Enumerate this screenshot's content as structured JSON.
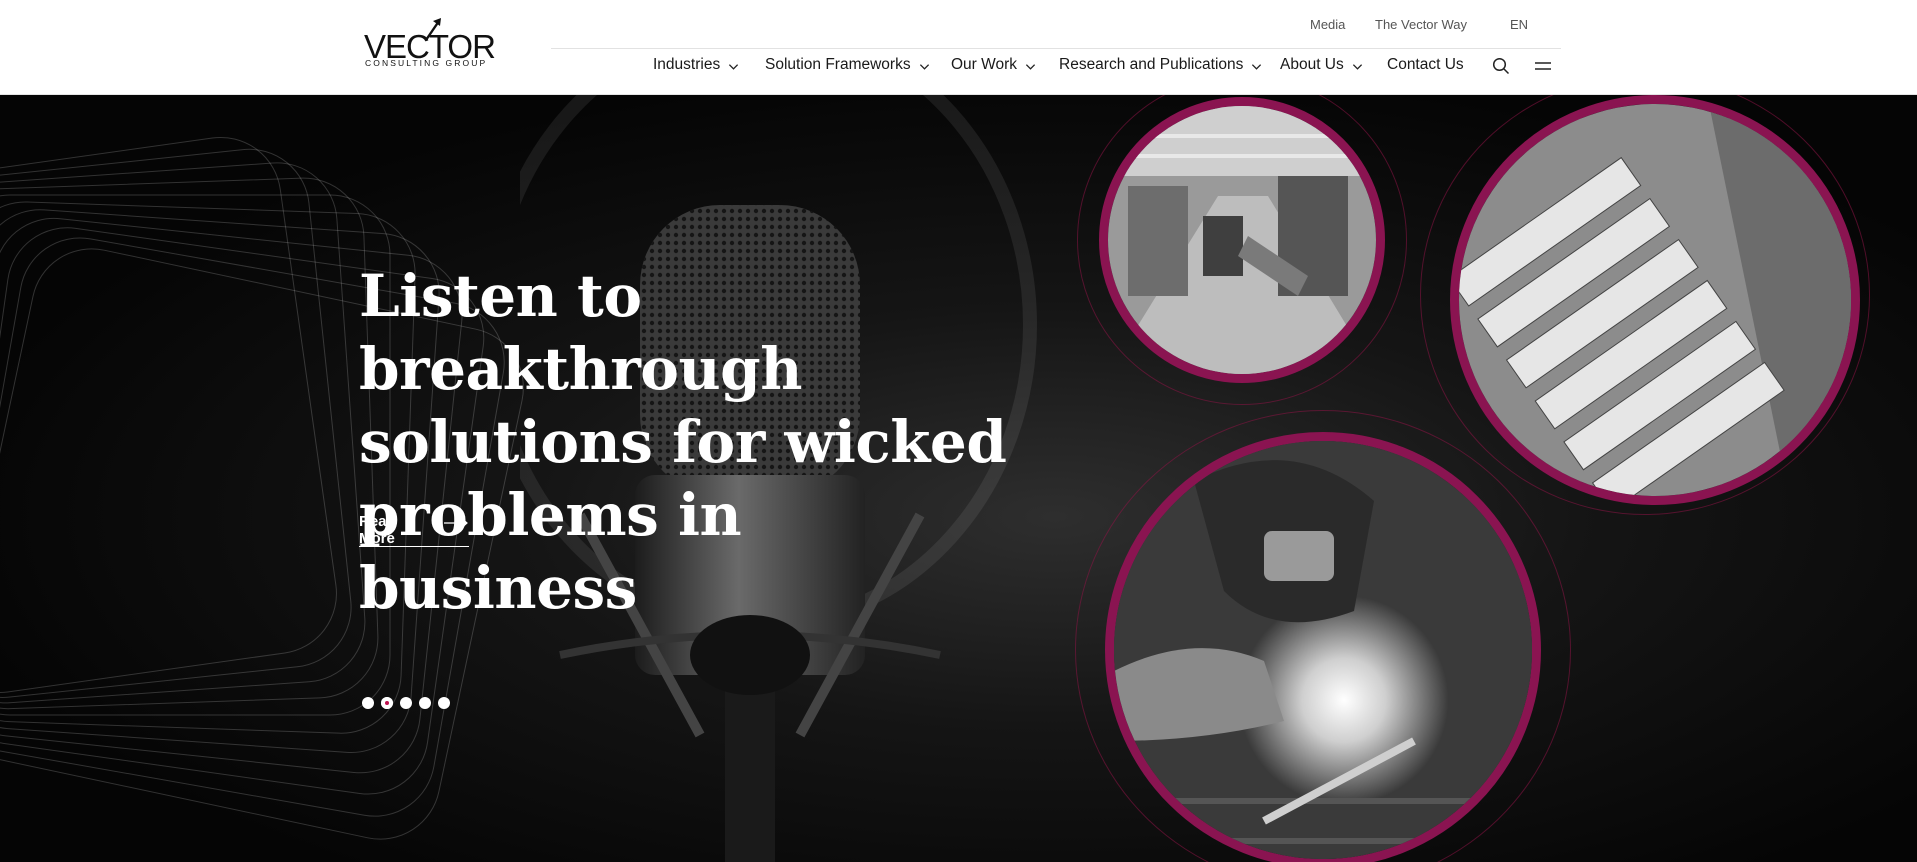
{
  "brand": {
    "logo_word": "VECTOR",
    "logo_sub": "CONSULTING GROUP"
  },
  "util_nav": {
    "media": "Media",
    "vector_way": "The Vector Way",
    "lang": "EN"
  },
  "main_nav": {
    "items": [
      {
        "label": "Industries",
        "has_dropdown": true
      },
      {
        "label": "Solution Frameworks",
        "has_dropdown": true
      },
      {
        "label": "Our Work",
        "has_dropdown": true
      },
      {
        "label": "Research and Publications",
        "has_dropdown": true
      },
      {
        "label": "About Us",
        "has_dropdown": true
      },
      {
        "label": "Contact Us",
        "has_dropdown": false
      }
    ],
    "icons": [
      "search-icon",
      "hamburger-menu-icon"
    ]
  },
  "hero": {
    "headline_line1": "Listen to breakthrough",
    "headline_line2": "solutions for wicked",
    "headline_line3": "problems in business",
    "cta_label": "Read More",
    "slides_total": 5,
    "active_slide": 2
  },
  "colors": {
    "accent": "#8a1451",
    "header_bg": "#ffffff",
    "hero_bg": "#0a0a0a",
    "text_light": "#ffffff"
  }
}
